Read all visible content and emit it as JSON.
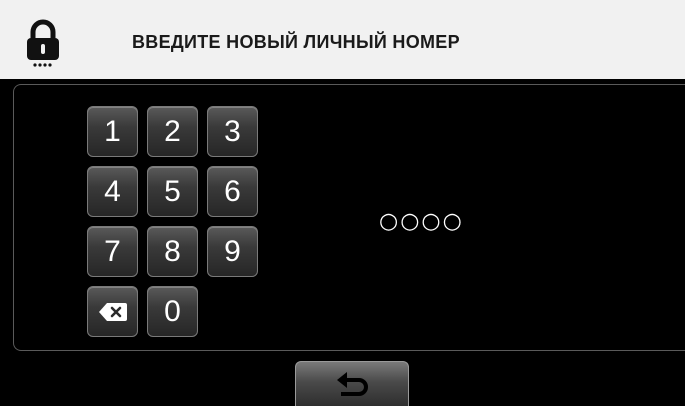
{
  "header": {
    "title": "ВВЕДИТЕ НОВЫЙ ЛИЧНЫЙ НОМЕР",
    "icon": "lock-icon"
  },
  "keypad": {
    "keys": [
      "1",
      "2",
      "3",
      "4",
      "5",
      "6",
      "7",
      "8",
      "9",
      "0"
    ],
    "delete_icon": "backspace-icon"
  },
  "pin_display": {
    "value": "○○○○"
  },
  "footer": {
    "back_icon": "return-arrow-icon"
  },
  "colors": {
    "header_bg": "#f1f1f1",
    "screen_bg": "#000000",
    "key_text": "#ffffff"
  }
}
